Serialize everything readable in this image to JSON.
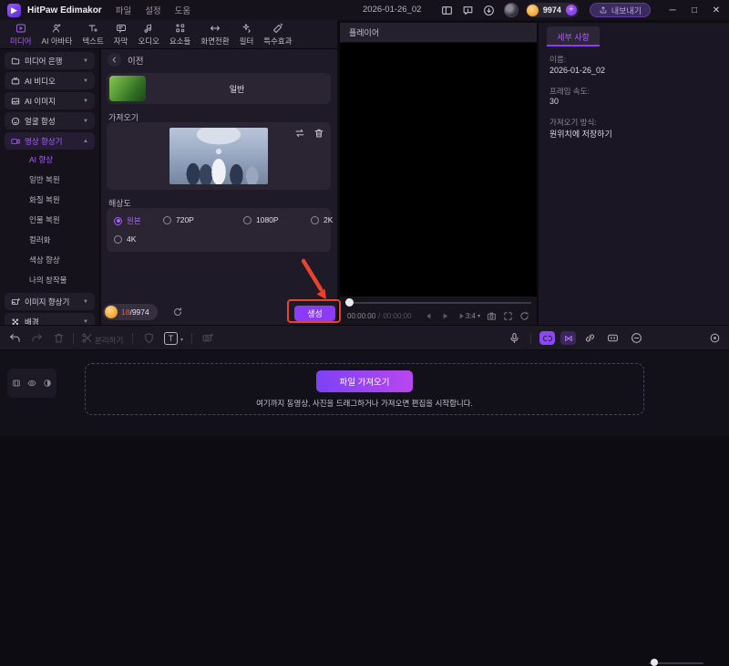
{
  "titlebar": {
    "app_name": "HitPaw Edimakor",
    "menus": [
      "파일",
      "설정",
      "도움"
    ],
    "document_title": "2026-01-26_02",
    "credits": "9974",
    "plus": "+",
    "export_label": "내보내기",
    "window": {
      "minimize": "─",
      "maximize": "□",
      "close": "✕"
    }
  },
  "tabs": [
    {
      "label": "미디어",
      "active": true
    },
    {
      "label": "AI 아바타"
    },
    {
      "label": "텍스트"
    },
    {
      "label": "자막"
    },
    {
      "label": "오디오"
    },
    {
      "label": "요소들"
    },
    {
      "label": "화면전환"
    },
    {
      "label": "필터"
    },
    {
      "label": "특수효과"
    }
  ],
  "sidebar": {
    "items": [
      {
        "label": "미디어 은행"
      },
      {
        "label": "AI 비디오"
      },
      {
        "label": "AI 이미지"
      },
      {
        "label": "얼굴 합성"
      },
      {
        "label": "영상 향상기",
        "active": true,
        "expanded": true
      },
      {
        "label": "이미지 향상기"
      },
      {
        "label": "배경"
      }
    ],
    "enhancer_children": [
      {
        "label": "AI 향상",
        "active": true
      },
      {
        "label": "일반 복원"
      },
      {
        "label": "화질 복원"
      },
      {
        "label": "인물 복원"
      },
      {
        "label": "컬러화"
      },
      {
        "label": "색상 향상"
      },
      {
        "label": "나의 창작물"
      }
    ]
  },
  "enhance_panel": {
    "back_label": "이전",
    "preset_label": "일반",
    "import_section_label": "가져오기",
    "resolution_section_label": "해상도",
    "resolution_options": [
      {
        "label": "원본",
        "selected": true
      },
      {
        "label": "720P"
      },
      {
        "label": "1080P"
      },
      {
        "label": "2K"
      },
      {
        "label": "4K"
      }
    ],
    "credits_used": "18",
    "credits_total": "/9974",
    "generate_label": "생성"
  },
  "player": {
    "title": "플레이어",
    "time_current": "00:00:00",
    "time_separator": "/",
    "time_total": "00:00:00",
    "aspect_ratio": "3:4"
  },
  "details": {
    "tab_label": "세부 사항",
    "fields": [
      {
        "label": "이름:",
        "value": "2026-01-26_02"
      },
      {
        "label": "프레임 속도:",
        "value": "30"
      },
      {
        "label": "가져오기 방식:",
        "value": "원위치에 저장하기"
      }
    ]
  },
  "toolbar": {
    "split_label": "분리하기",
    "text_tool_glyph": "T"
  },
  "timeline": {
    "import_button_label": "파일 가져오기",
    "hint": "여기까지 동영상, 사진을 드래그하거나 가져오면 편집을 시작합니다."
  },
  "icons": [
    "media",
    "ai-avatar",
    "text",
    "subtitle",
    "audio",
    "elements",
    "transition",
    "filter",
    "effects",
    "folder",
    "ai-video",
    "ai-image",
    "face-swap",
    "video-enhancer",
    "image-enhancer",
    "checkerboard",
    "back-chevron",
    "swap",
    "trash",
    "refresh",
    "undo",
    "redo",
    "scissors",
    "shield",
    "text-tool",
    "camera-plus",
    "mic",
    "snap",
    "ripple",
    "link",
    "track-frame",
    "zoom-out",
    "fit",
    "prev-frame",
    "play",
    "next-frame",
    "snapshot",
    "frame",
    "loop",
    "video-track",
    "eye",
    "audio-half",
    "layout",
    "feedback",
    "download",
    "export",
    "coin",
    "avatar"
  ],
  "annotation": {
    "color": "#e8432d"
  },
  "colors": {
    "accent": "#a964f8",
    "generate_button": "#8b3bf5",
    "coin": "#f2a93b",
    "annotation": "#e8432d"
  }
}
